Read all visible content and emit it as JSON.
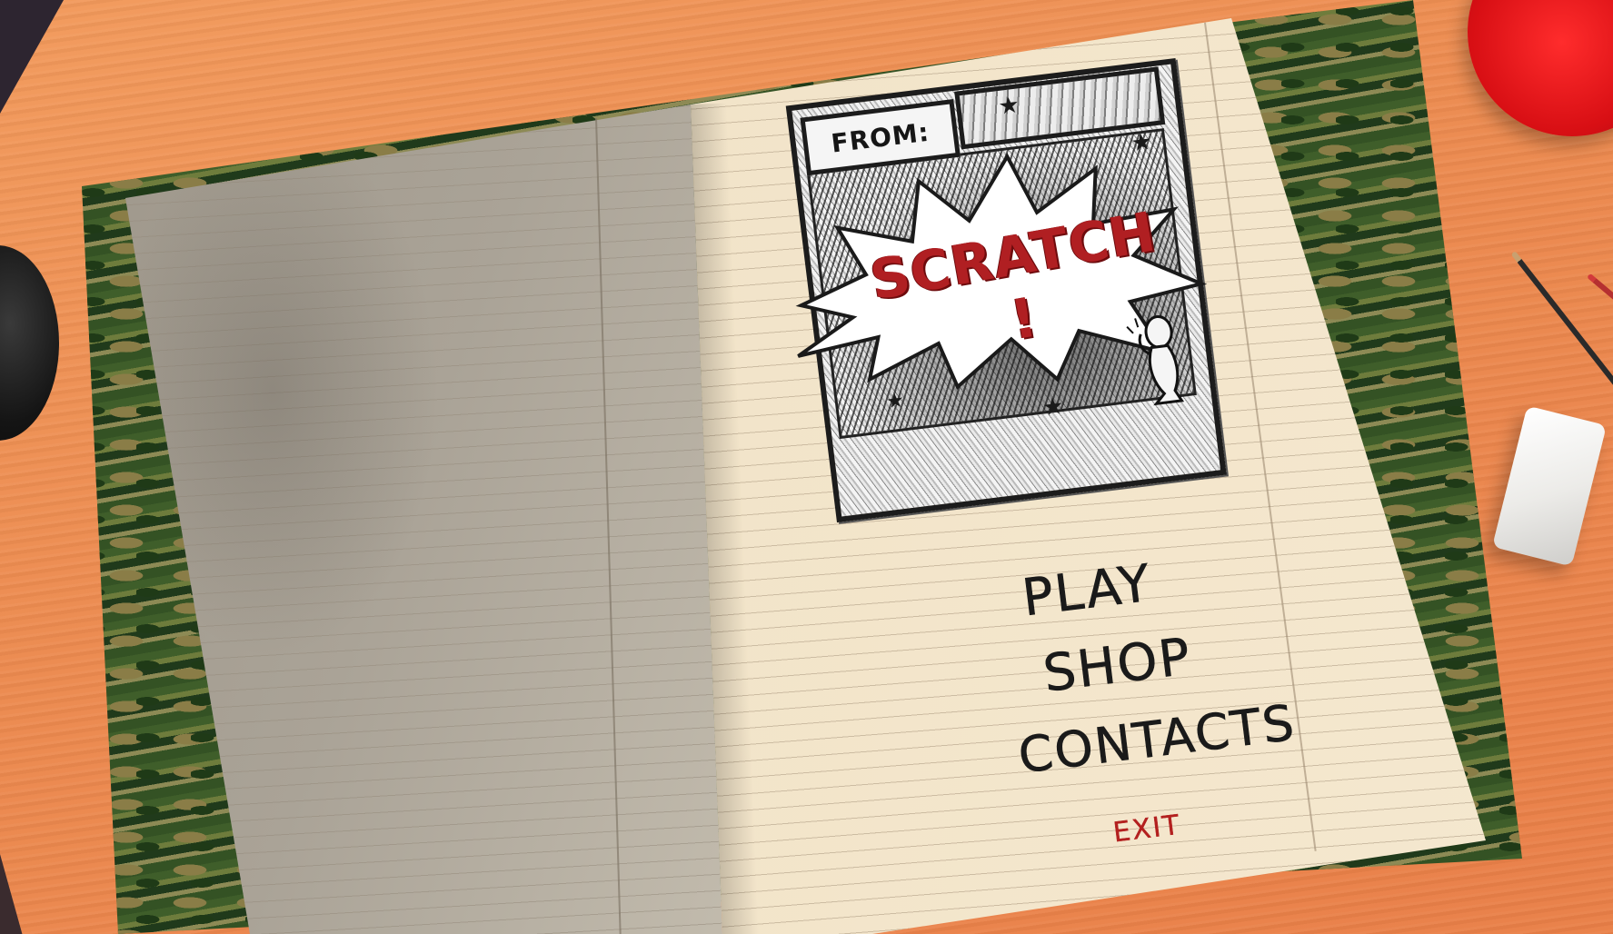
{
  "logo": {
    "from_label": "FROM:",
    "title": "SCRATCH !"
  },
  "menu": {
    "play": "PLAY",
    "shop": "SHOP",
    "contacts": "CONTACTS",
    "exit": "EXIT"
  },
  "colors": {
    "desk": "#ec8a4f",
    "title_red": "#b01f22",
    "exit_red": "#b3201f",
    "ink": "#1a1a1a",
    "page_right": "#f2e4c9",
    "page_left": "#aaa397"
  },
  "icons": [
    "star-icon",
    "star-icon",
    "star-icon",
    "star-icon",
    "doodle-figure-icon"
  ]
}
